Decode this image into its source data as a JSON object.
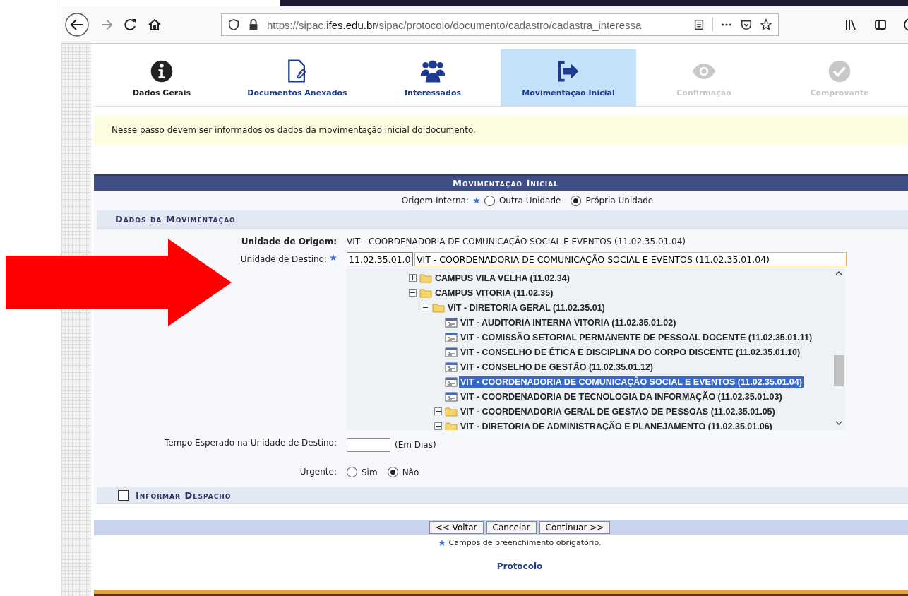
{
  "browser": {
    "url": {
      "prefix": "https://sipac.",
      "domain": "ifes.edu.br",
      "path": "/sipac/protocolo/documento/cadastro/cadastra_interessa"
    }
  },
  "steps": [
    {
      "label": "Dados Gerais",
      "disabled": false,
      "selected": false
    },
    {
      "label": "Documentos Anexados",
      "disabled": false,
      "selected": false
    },
    {
      "label": "Interessados",
      "disabled": false,
      "selected": false
    },
    {
      "label": "Movimentação Inicial",
      "disabled": false,
      "selected": true
    },
    {
      "label": "Confirmação",
      "disabled": true,
      "selected": false
    },
    {
      "label": "Comprovante",
      "disabled": true,
      "selected": false
    }
  ],
  "info_message": "Nesse passo devem ser informados os dados da movimentação inicial do documento.",
  "form": {
    "title": "Movimentação Inicial",
    "origem_interna": {
      "label": "Origem Interna:",
      "required": true,
      "options": [
        {
          "label": "Outra Unidade",
          "selected": false
        },
        {
          "label": "Própria Unidade",
          "selected": true
        }
      ]
    },
    "section_title": "Dados da Movimentação",
    "unidade_origem": {
      "label": "Unidade de Origem:",
      "value": "VIT - COORDENADORIA DE COMUNICAÇÃO SOCIAL E EVENTOS (11.02.35.01.04)"
    },
    "unidade_destino": {
      "label": "Unidade de Destino:",
      "required": true,
      "code": "11.02.35.01.0",
      "name": "VIT - COORDENADORIA DE COMUNICAÇÃO SOCIAL E EVENTOS (11.02.35.01.04)"
    },
    "tree": [
      {
        "kind": "folder",
        "label": "CAMPUS VILA VELHA (11.02.34)",
        "expanded": false,
        "selected": false
      },
      {
        "kind": "folder",
        "label": "CAMPUS VITORIA (11.02.35)",
        "expanded": true,
        "selected": false,
        "children": [
          {
            "kind": "folder",
            "label": "VIT - DIRETORIA GERAL (11.02.35.01)",
            "expanded": true,
            "selected": false,
            "children": [
              {
                "kind": "unit",
                "label": "VIT - AUDITORIA INTERNA VITORIA (11.02.35.01.02)",
                "selected": false
              },
              {
                "kind": "unit",
                "label": "VIT - COMISSÃO SETORIAL PERMANENTE DE PESSOAL DOCENTE (11.02.35.01.11)",
                "selected": false
              },
              {
                "kind": "unit",
                "label": "VIT - CONSELHO DE ÉTICA E DISCIPLINA DO CORPO DISCENTE (11.02.35.01.10)",
                "selected": false
              },
              {
                "kind": "unit",
                "label": "VIT - CONSELHO DE GESTÃO (11.02.35.01.12)",
                "selected": false
              },
              {
                "kind": "unit",
                "label": "VIT - COORDENADORIA DE COMUNICAÇÃO SOCIAL E EVENTOS (11.02.35.01.04)",
                "selected": true
              },
              {
                "kind": "unit",
                "label": "VIT - COORDENADORIA DE TECNOLOGIA DA INFORMAÇÃO (11.02.35.01.03)",
                "selected": false
              },
              {
                "kind": "folder",
                "label": "VIT - COORDENADORIA GERAL DE GESTAO DE PESSOAS (11.02.35.01.05)",
                "expanded": false,
                "selected": false
              },
              {
                "kind": "folder",
                "label": "VIT - DIRETORIA DE ADMINISTRAÇÃO E PLANEJAMENTO (11.02.35.01.06)",
                "expanded": false,
                "selected": false
              }
            ]
          }
        ]
      }
    ],
    "tempo": {
      "label": "Tempo Esperado na Unidade de Destino:",
      "unit": "(Em Dias)"
    },
    "urgente": {
      "label": "Urgente:",
      "options": [
        {
          "label": "Sim",
          "selected": false
        },
        {
          "label": "Não",
          "selected": true
        }
      ]
    },
    "despacho": {
      "label": "Informar Despacho",
      "checked": false
    },
    "buttons": [
      "<< Voltar",
      "Cancelar",
      "Continuar >>"
    ],
    "required_note": "Campos de preenchimento obrigatório."
  },
  "footer_link": "Protocolo"
}
